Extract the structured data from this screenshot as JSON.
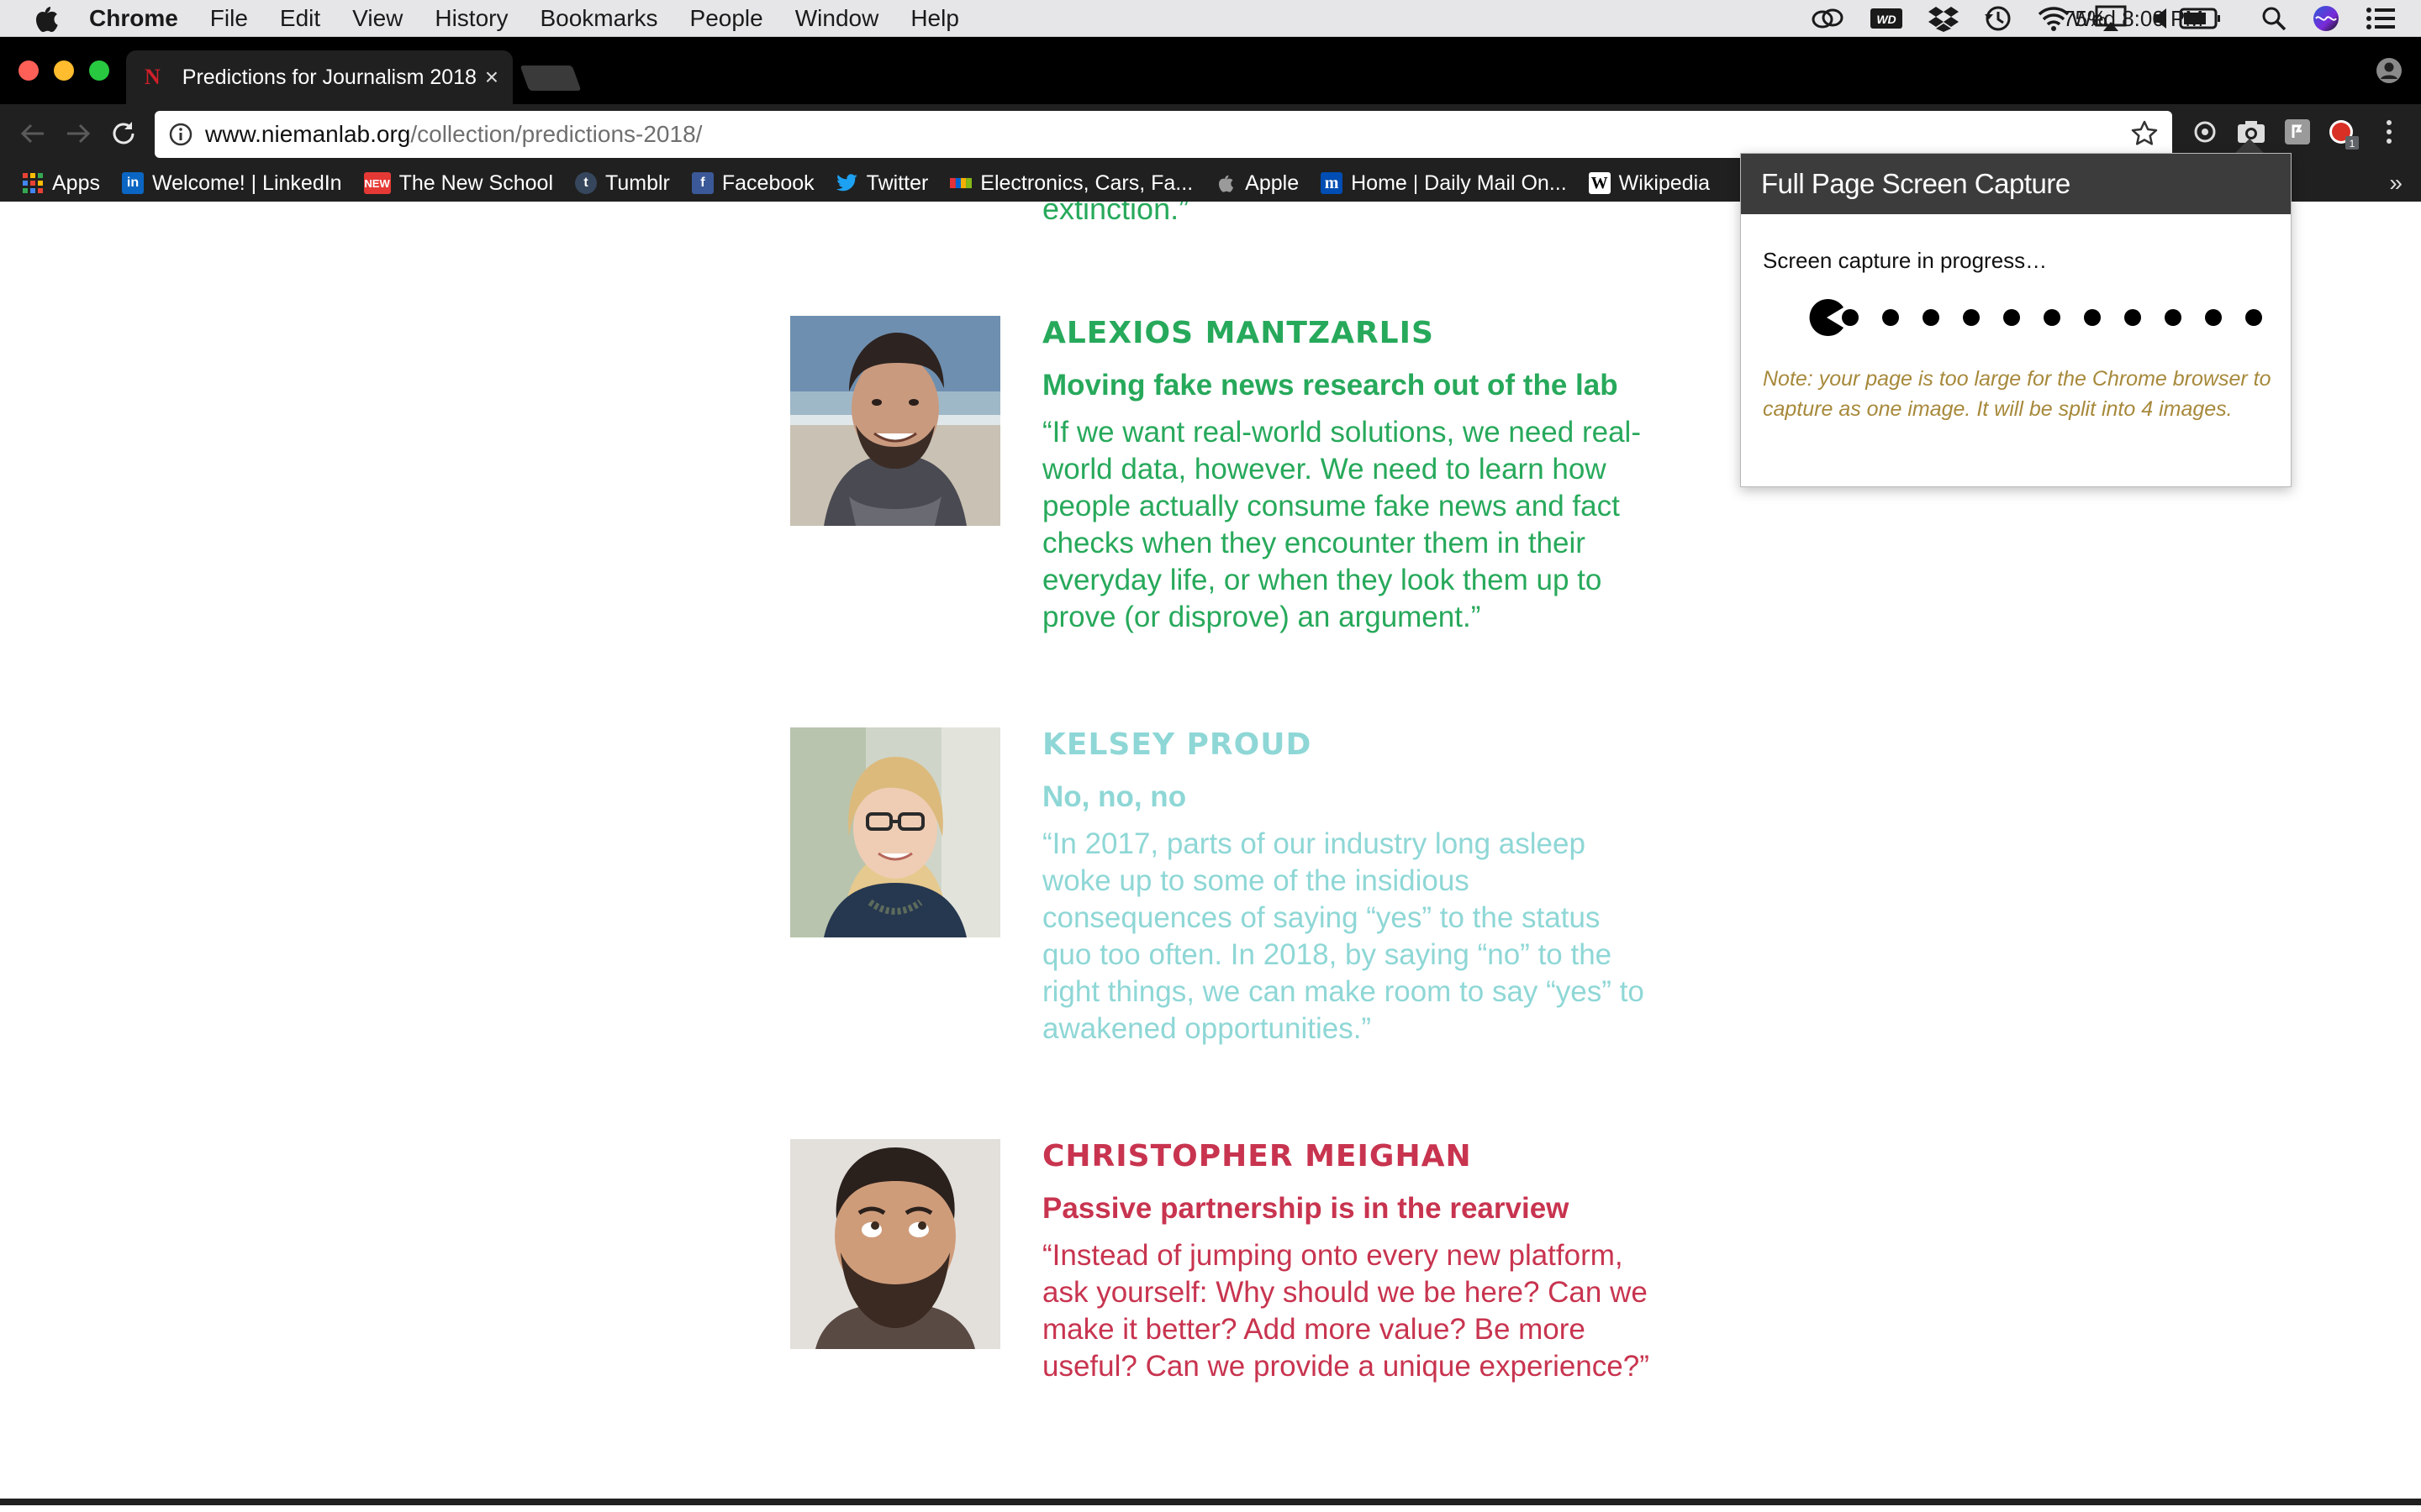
{
  "menubar": {
    "app": "Chrome",
    "items": [
      "File",
      "Edit",
      "View",
      "History",
      "Bookmarks",
      "People",
      "Window",
      "Help"
    ],
    "battery": "75%",
    "clock": "Wed 8:00 PM"
  },
  "tab": {
    "favicon": "N",
    "title": "Predictions for Journalism 2018",
    "close": "×"
  },
  "omnibox": {
    "host": "www.niemanlab.org",
    "path": "/collection/predictions-2018/"
  },
  "bookmarks": [
    {
      "label": "Apps",
      "icon": "apps-grid-icon",
      "color": "#e94235"
    },
    {
      "label": "Welcome! | LinkedIn",
      "icon": "in",
      "color": "#0a66c2"
    },
    {
      "label": "The New School",
      "icon": "NEW",
      "color": "#e53935"
    },
    {
      "label": "Tumblr",
      "icon": "t",
      "color": "#36465d"
    },
    {
      "label": "Facebook",
      "icon": "f",
      "color": "#3b5998"
    },
    {
      "label": "Twitter",
      "icon": "twitter-bird-icon",
      "color": "#1da1f2"
    },
    {
      "label": "Electronics, Cars, Fa...",
      "icon": "ebay-icon",
      "color": "#e53238"
    },
    {
      "label": "Apple",
      "icon": "apple-icon",
      "color": "#888888"
    },
    {
      "label": "Home | Daily Mail On...",
      "icon": "m",
      "color": "#004db3"
    },
    {
      "label": "Wikipedia",
      "icon": "W",
      "color": "#ffffff"
    }
  ],
  "bookmarks_more": "»",
  "page": {
    "fragment": "extinction.”",
    "entries": [
      {
        "name": "ALEXIOS MANTZARLIS",
        "headline": "Moving fake news research out of the lab",
        "quote": "“If we want real-world solutions, we need real-world data, however. We need to learn how people actually consume fake news and fact checks when they encounter them in their everyday life, or when they look them up to prove (or disprove) an argument.”",
        "color": "#27a95b"
      },
      {
        "name": "KELSEY PROUD",
        "headline": "No, no, no",
        "quote": "“In 2017, parts of our industry long asleep woke up to some of the insidious consequences of saying “yes” to the status quo too often. In 2018, by saying “no” to the right things, we can make room to say “yes” to awakened opportunities.”",
        "color": "#8ed7d6"
      },
      {
        "name": "CHRISTOPHER MEIGHAN",
        "headline": "Passive partnership is in the rearview",
        "quote": "“Instead of jumping onto every new platform, ask yourself: Why should we be here? Can we make it better? Add more value? Be more useful? Can we provide a unique experience?”",
        "color": "#c8344f"
      }
    ]
  },
  "popup": {
    "title": "Full Page Screen Capture",
    "status": "Screen capture in progress…",
    "note": "Note: your page is too large for the Chrome browser to capture as one image. It will be split into 4 images.",
    "note_color": "#a7893b"
  }
}
